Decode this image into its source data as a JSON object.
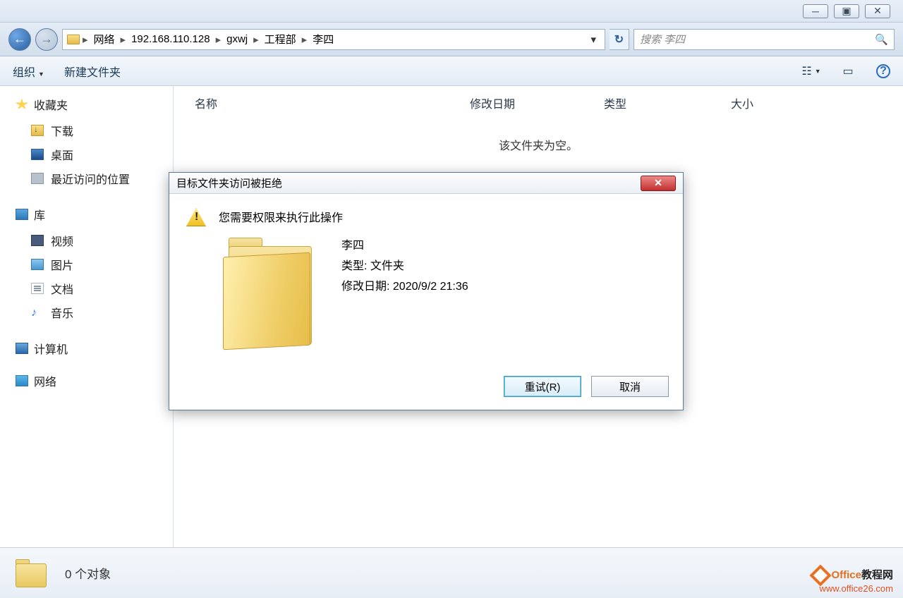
{
  "window": {
    "minimize": "─",
    "maximize": "▣",
    "close": "✕"
  },
  "nav": {
    "back": "←",
    "forward": "→",
    "crumbs": [
      "网络",
      "192.168.110.128",
      "gxwj",
      "工程部",
      "李四"
    ],
    "refresh": "↻",
    "search_placeholder": "搜索 李四",
    "search_icon": "🔍"
  },
  "toolbar": {
    "organize": "组织",
    "newfolder": "新建文件夹",
    "view_icon": "☷",
    "preview_icon": "▭",
    "help_icon": "?"
  },
  "columns": {
    "name": "名称",
    "date": "修改日期",
    "type": "类型",
    "size": "大小"
  },
  "content": {
    "empty": "该文件夹为空。"
  },
  "sidebar": {
    "favorites": "收藏夹",
    "downloads": "下载",
    "desktop": "桌面",
    "recent": "最近访问的位置",
    "libraries": "库",
    "videos": "视频",
    "pictures": "图片",
    "documents": "文档",
    "music": "音乐",
    "computer": "计算机",
    "network": "网络"
  },
  "dialog": {
    "title": "目标文件夹访问被拒绝",
    "message": "您需要权限来执行此操作",
    "folder_name": "李四",
    "type_label": "类型: 文件夹",
    "date_label": "修改日期: 2020/9/2 21:36",
    "retry": "重试(R)",
    "cancel": "取消",
    "close": "✕"
  },
  "status": {
    "text": "0 个对象"
  },
  "watermark": {
    "line1a": "Office",
    "line1b": "教程网",
    "line2": "www.office26.com"
  }
}
